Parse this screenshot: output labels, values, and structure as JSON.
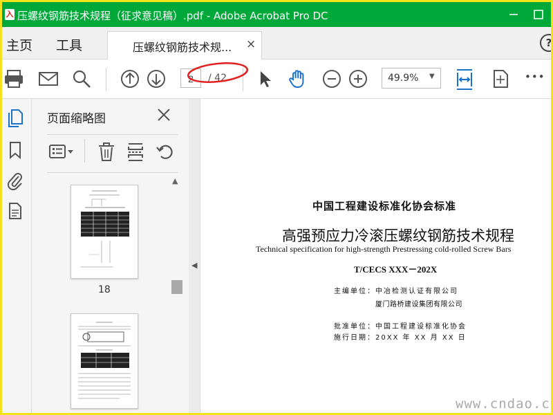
{
  "window": {
    "title": "压螺纹钢筋技术规程（征求意见稿）.pdf - Adobe Acrobat Pro DC",
    "app_icon_text": "入"
  },
  "menu": {
    "home": "主页",
    "tools": "工具"
  },
  "tab": {
    "label": "压螺纹钢筋技术规...",
    "close": "×"
  },
  "help": {
    "label": "?"
  },
  "toolbar": {
    "page_current": "2",
    "page_total": "/ 42",
    "zoom": "49.9%",
    "zoom_caret": "▼",
    "more": "•••"
  },
  "panel": {
    "title": "页面缩略图",
    "thumbs": [
      {
        "label": "18"
      }
    ]
  },
  "scroll": {
    "up": "▲"
  },
  "collapse": {
    "arrow": "◀"
  },
  "document": {
    "std_title": "中国工程建设标准化协会标准",
    "title_cn": "高强预应力冷滚压螺纹钢筋技术规程",
    "title_en": "Technical specification for high-strength Prestressing cold-rolled Screw Bars",
    "code": "T/CECS XXX－202X",
    "editor_line1": "主编单位：中冶检测认证有限公司",
    "editor_line2": "厦门路桥建设集团有限公司",
    "approve_line": "批准单位：中国工程建设标准化协会",
    "date_line": "施行日期：20XX 年 XX 月 XX 日"
  },
  "watermark": "www.cndao.com",
  "colors": {
    "titlebar": "#00a83a",
    "frame": "#f4e21b",
    "accent_blue": "#1a73c9",
    "annotation_red": "#e02020"
  }
}
